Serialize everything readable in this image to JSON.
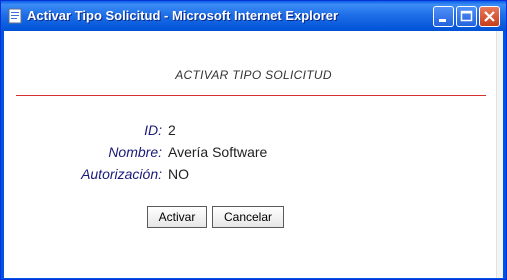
{
  "window": {
    "title": "Activar Tipo Solicitud - Microsoft Internet Explorer"
  },
  "content": {
    "heading": "ACTIVAR TIPO SOLICITUD",
    "fields": [
      {
        "label": "ID:",
        "value": "2"
      },
      {
        "label": "Nombre:",
        "value": "Avería Software"
      },
      {
        "label": "Autorización:",
        "value": "NO"
      }
    ],
    "buttons": {
      "activar": "Activar",
      "cancelar": "Cancelar"
    }
  },
  "icons": [
    "ie-page-icon",
    "minimize-icon",
    "maximize-icon",
    "close-icon"
  ],
  "colors": {
    "titlebar": "#0054e3",
    "rule": "#d43030",
    "label": "#1a1a7a"
  }
}
